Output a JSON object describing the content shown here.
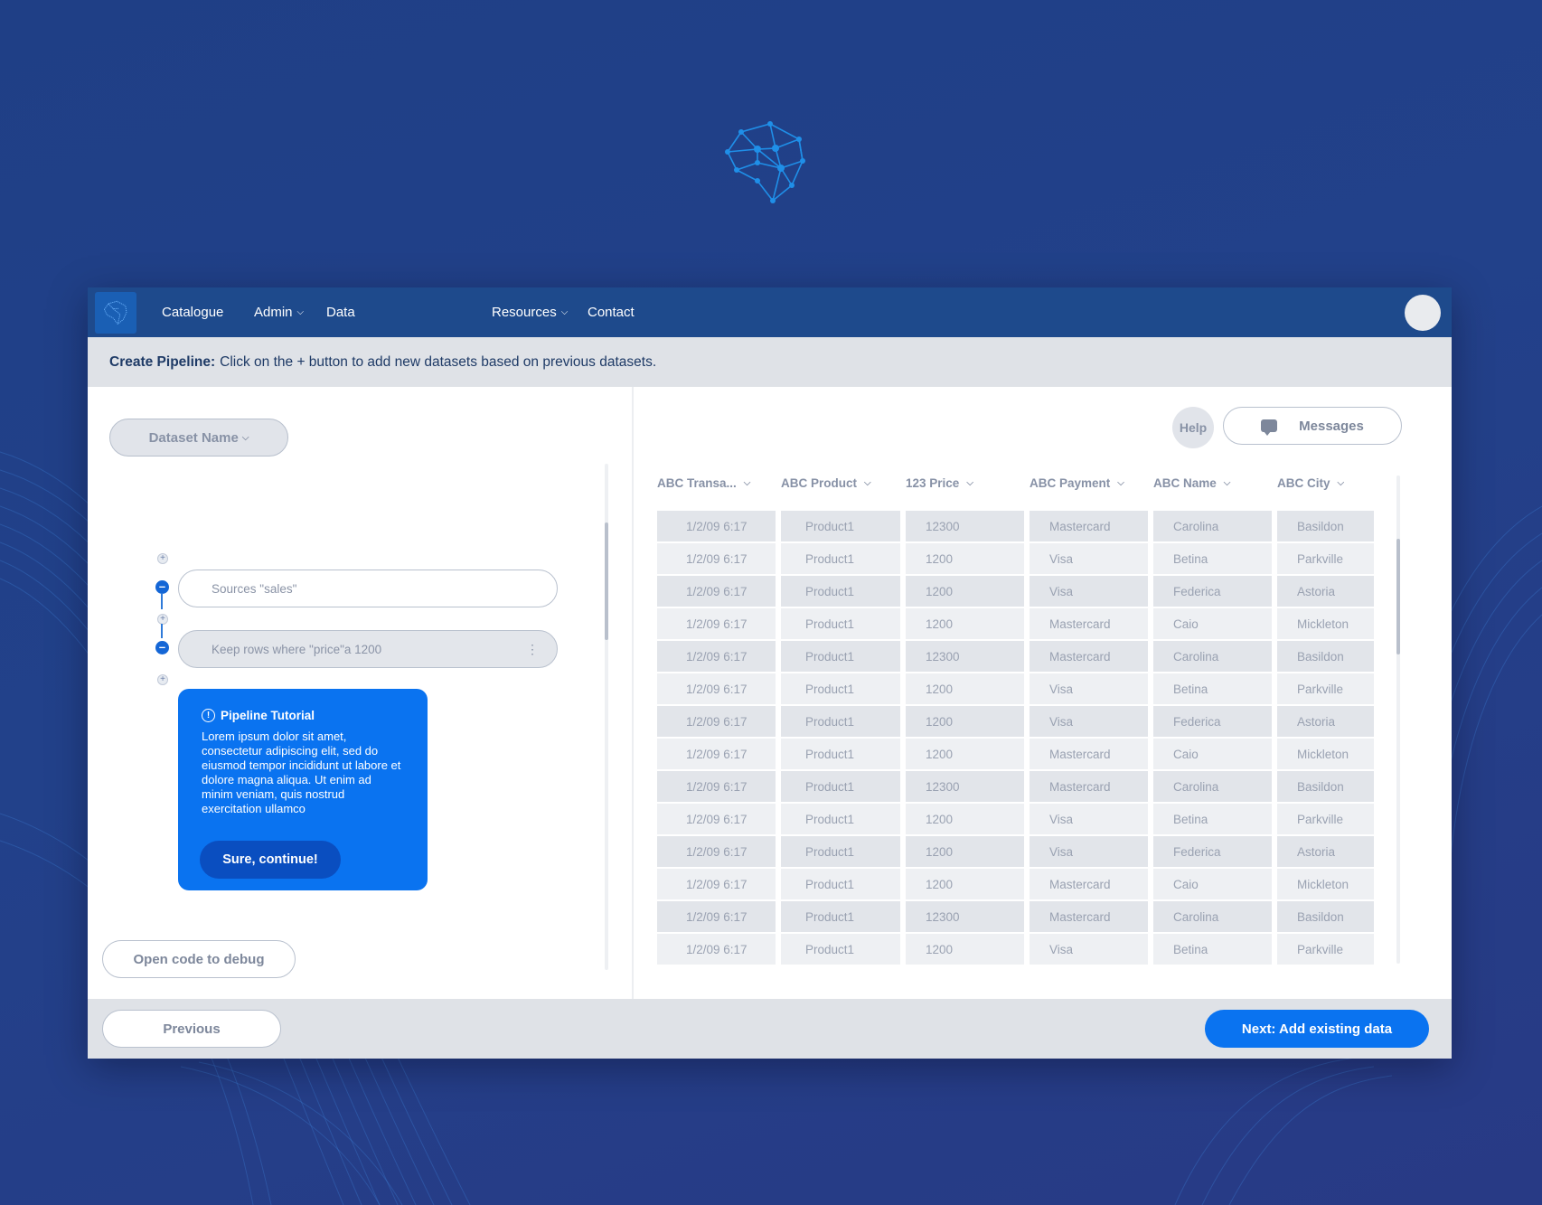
{
  "nav": {
    "items": [
      {
        "label": "Catalogue"
      },
      {
        "label": "Admin"
      },
      {
        "label": "Data"
      },
      {
        "label": "Resources"
      },
      {
        "label": "Contact"
      }
    ]
  },
  "info": {
    "title": "Create Pipeline:",
    "text": "Click on the + button to add new datasets based on previous datasets."
  },
  "left": {
    "dataset_button": "Dataset Name",
    "steps": [
      {
        "label": "Sources \"sales\""
      },
      {
        "label": "Keep rows where \"price\"a 1200"
      }
    ],
    "tutorial": {
      "title": "Pipeline Tutorial",
      "body": "Lorem ipsum dolor sit amet, consectetur adipiscing elit, sed do eiusmod tempor incididunt ut labore et dolore magna aliqua. Ut enim ad minim veniam, quis nostrud exercitation ullamco",
      "button": "Sure, continue!"
    },
    "debug_button": "Open code to debug"
  },
  "right": {
    "help_label": "Help",
    "messages_label": "Messages",
    "columns": [
      "ABC Transa...",
      "ABC Product",
      "123 Price",
      "ABC Payment",
      "ABC Name",
      "ABC City"
    ],
    "rows": [
      [
        "1/2/09 6:17",
        "Product1",
        "12300",
        "Mastercard",
        "Carolina",
        "Basildon"
      ],
      [
        "1/2/09 6:17",
        "Product1",
        "1200",
        "Visa",
        "Betina",
        "Parkville"
      ],
      [
        "1/2/09 6:17",
        "Product1",
        "1200",
        "Visa",
        "Federica",
        "Astoria"
      ],
      [
        "1/2/09 6:17",
        "Product1",
        "1200",
        "Mastercard",
        "Caio",
        "Mickleton"
      ],
      [
        "1/2/09 6:17",
        "Product1",
        "12300",
        "Mastercard",
        "Carolina",
        "Basildon"
      ],
      [
        "1/2/09 6:17",
        "Product1",
        "1200",
        "Visa",
        "Betina",
        "Parkville"
      ],
      [
        "1/2/09 6:17",
        "Product1",
        "1200",
        "Visa",
        "Federica",
        "Astoria"
      ],
      [
        "1/2/09 6:17",
        "Product1",
        "1200",
        "Mastercard",
        "Caio",
        "Mickleton"
      ],
      [
        "1/2/09 6:17",
        "Product1",
        "12300",
        "Mastercard",
        "Carolina",
        "Basildon"
      ],
      [
        "1/2/09 6:17",
        "Product1",
        "1200",
        "Visa",
        "Betina",
        "Parkville"
      ],
      [
        "1/2/09 6:17",
        "Product1",
        "1200",
        "Visa",
        "Federica",
        "Astoria"
      ],
      [
        "1/2/09 6:17",
        "Product1",
        "1200",
        "Mastercard",
        "Caio",
        "Mickleton"
      ],
      [
        "1/2/09 6:17",
        "Product1",
        "12300",
        "Mastercard",
        "Carolina",
        "Basildon"
      ],
      [
        "1/2/09 6:17",
        "Product1",
        "1200",
        "Visa",
        "Betina",
        "Parkville"
      ]
    ]
  },
  "footer": {
    "previous": "Previous",
    "next": "Next: Add existing data"
  },
  "colors": {
    "accent": "#0a73f0",
    "nav": "#1e4a8c",
    "background": "#22418a"
  },
  "icons": [
    "brain-network-logo-icon",
    "chevron-down-icon",
    "avatar",
    "plus-icon",
    "minus-icon",
    "info-icon",
    "kebab-menu-icon",
    "chat-icon"
  ]
}
